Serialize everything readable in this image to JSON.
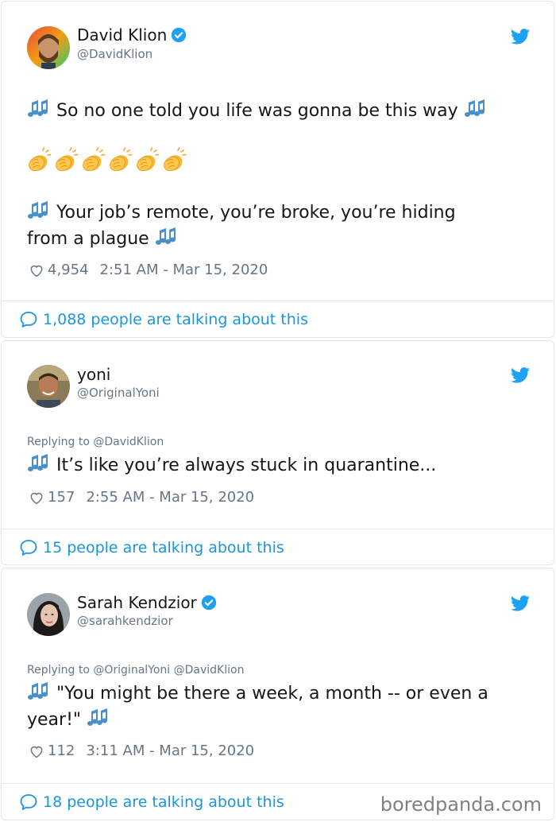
{
  "tweets": [
    {
      "name": "David Klion",
      "handle": "@DavidKlion",
      "verified": true,
      "reply_to": "",
      "text_line1": "So no one told you life was gonna be this way",
      "claps": 6,
      "text_line2a": "Your job’s remote, you’re broke, you’re hiding",
      "text_line2b": "from a plague",
      "likes": "4,954",
      "timestamp": "2:51 AM - Mar 15, 2020",
      "talking": "1,088 people are talking about this"
    },
    {
      "name": "yoni",
      "handle": "@OriginalYoni",
      "verified": false,
      "reply_to": "Replying to @DavidKlion",
      "text_line1": "It’s like you’re always stuck in quarantine...",
      "likes": "157",
      "timestamp": "2:55 AM - Mar 15, 2020",
      "talking": "15 people are talking about this"
    },
    {
      "name": "Sarah Kendzior",
      "handle": "@sarahkendzior",
      "verified": true,
      "reply_to": "Replying to @OriginalYoni @DavidKlion",
      "text_line1": "\"You might be there a week, a month -- or even a",
      "text_line2": "year!\"",
      "likes": "112",
      "timestamp": "3:11 AM - Mar 15, 2020",
      "talking": "18 people are talking about this"
    }
  ],
  "watermark": "boredpanda.com",
  "colors": {
    "link": "#1b95e0",
    "muted": "#657786",
    "text": "#14171a",
    "border": "#e1e8ed"
  },
  "icons": [
    "musical-notes-icon",
    "clapping-hands-icon",
    "heart-icon",
    "speech-bubble-icon",
    "twitter-bird-icon",
    "verified-badge-icon"
  ]
}
